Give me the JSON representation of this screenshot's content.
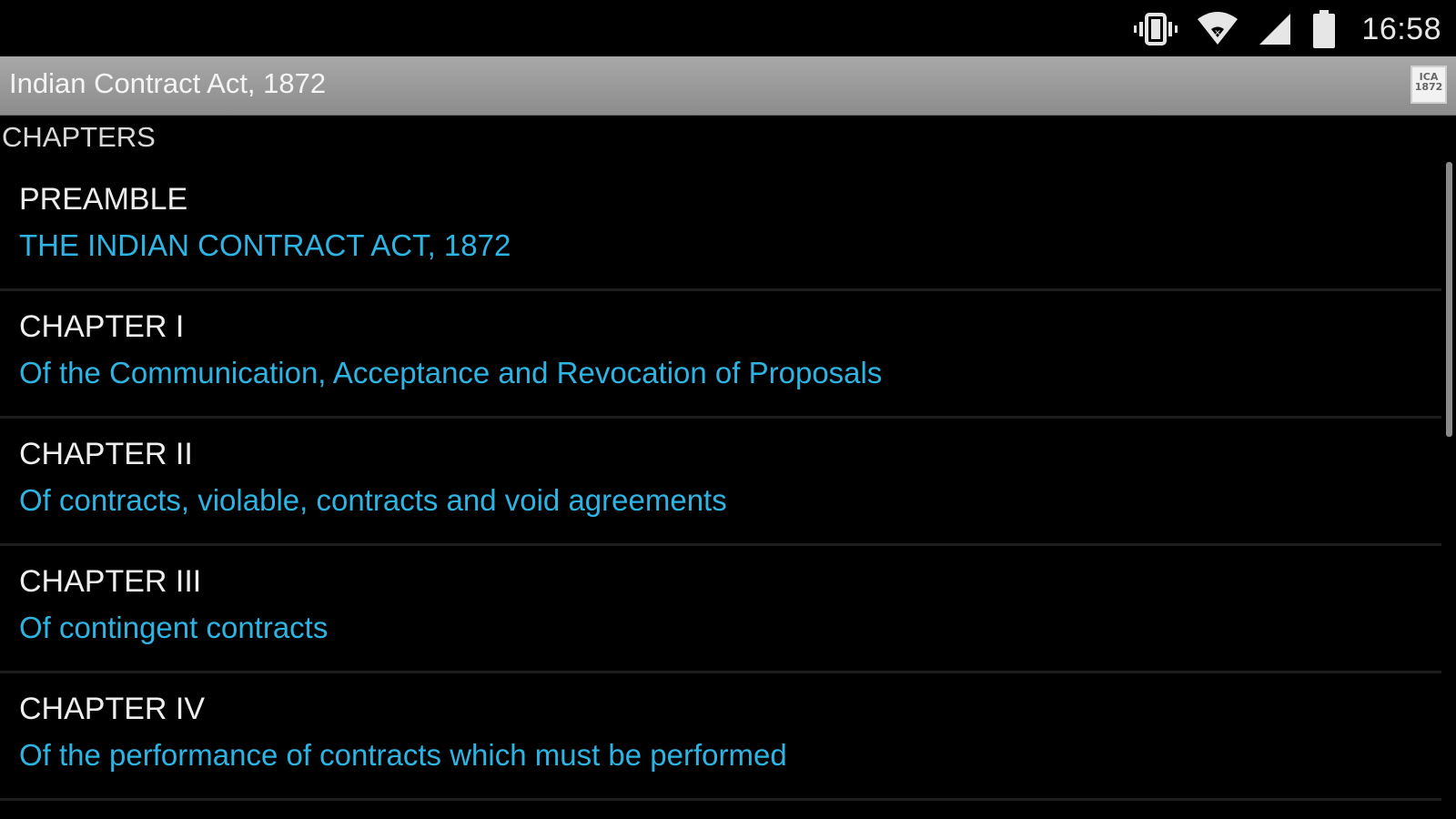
{
  "status_bar": {
    "time": "16:58",
    "icons": [
      "vibrate-icon",
      "wifi-icon",
      "cell-signal-icon",
      "battery-icon"
    ]
  },
  "action_bar": {
    "title": "Indian Contract Act, 1872",
    "app_icon_label": "ICA 1872"
  },
  "section_header": "CHAPTERS",
  "chapters": [
    {
      "title": "PREAMBLE",
      "subtitle": "THE INDIAN CONTRACT ACT, 1872"
    },
    {
      "title": "CHAPTER I",
      "subtitle": "Of the Communication, Acceptance and Revocation of Proposals"
    },
    {
      "title": "CHAPTER II",
      "subtitle": "Of contracts, violable, contracts and void agreements"
    },
    {
      "title": "CHAPTER III",
      "subtitle": "Of contingent contracts"
    },
    {
      "title": "CHAPTER IV",
      "subtitle": "Of the performance of contracts which must be performed"
    }
  ],
  "colors": {
    "accent": "#2db4e3",
    "action_bar": "#9c9c9c",
    "background": "#000000",
    "title_text": "#eeeeee"
  }
}
